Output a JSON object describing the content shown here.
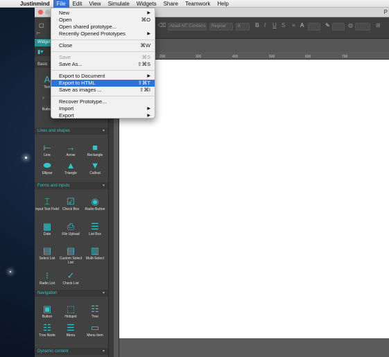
{
  "menubar": {
    "apple_icon": "apple-logo-icon",
    "app_name": "Justinmind",
    "items": [
      "File",
      "Edit",
      "View",
      "Simulate",
      "Widgets",
      "Share",
      "Teamwork",
      "Help"
    ]
  },
  "window": {
    "title_fragment": "P"
  },
  "toolbar": {
    "font_family": "Abadi MT Condens",
    "font_style": "Regular",
    "font_size": "8",
    "bold": "B",
    "italic": "I",
    "underline": "U",
    "font_color": "A"
  },
  "panel": {
    "tab_label": "Widgets",
    "sections": {
      "basic": "Basic",
      "lines": "Lines and shapes",
      "forms": "Forms and inputs",
      "navigation": "Navigation",
      "dynamic": "Dynamic content"
    },
    "basic_widgets": [
      "Text",
      "Button"
    ],
    "lines_widgets": [
      "Line",
      "Arrow",
      "Rectangle",
      "Ellipse",
      "Triangle",
      "Callout"
    ],
    "forms_widgets": [
      "Input Text Field",
      "Check Box",
      "Radio Button",
      "Date",
      "File Upload",
      "List Box",
      "Select List",
      "Custom Select List",
      "Multi-Select",
      "Radio List",
      "Check List"
    ],
    "nav_widgets": [
      "Button",
      "Hotspot",
      "Tree",
      "Tree Node",
      "Menu",
      "Menu Item"
    ]
  },
  "ruler": {
    "marks": [
      "100",
      "200",
      "300",
      "400",
      "500",
      "600",
      "700"
    ]
  },
  "file_menu": {
    "items": [
      {
        "label": "New",
        "shortcut": "",
        "submenu": true
      },
      {
        "label": "Open",
        "shortcut": "⌘O"
      },
      {
        "label": "Open shared prototype...",
        "shortcut": ""
      },
      {
        "label": "Recently Opened Prototypes",
        "shortcut": "",
        "submenu": true
      },
      {
        "label": "Close",
        "shortcut": "⌘W"
      },
      {
        "label": "Save",
        "shortcut": "⌘S",
        "disabled": true
      },
      {
        "label": "Save As...",
        "shortcut": "⇧⌘S"
      },
      {
        "label": "Export to Document",
        "shortcut": "",
        "submenu": true
      },
      {
        "label": "Export to HTML",
        "shortcut": "⇧⌘T",
        "highlighted": true
      },
      {
        "label": "Save as images ...",
        "shortcut": "⇧⌘I"
      },
      {
        "label": "Recover Prototype...",
        "shortcut": ""
      },
      {
        "label": "Import",
        "shortcut": "",
        "submenu": true
      },
      {
        "label": "Export",
        "shortcut": "",
        "submenu": true
      }
    ]
  },
  "colors": {
    "accent": "#36c2cb",
    "highlight": "#2f73d9"
  }
}
